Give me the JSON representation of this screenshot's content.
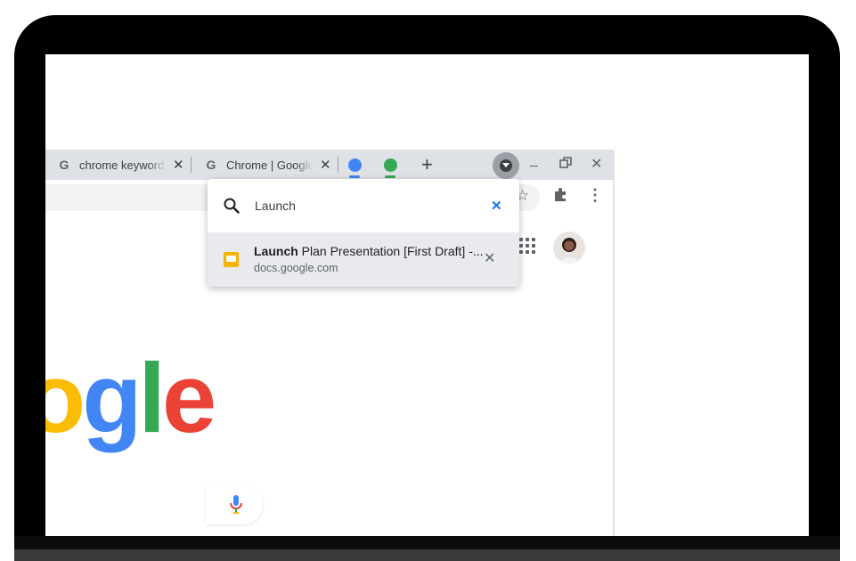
{
  "tabs": [
    {
      "favicon": "G",
      "title": "chrome keywords"
    },
    {
      "favicon": "G",
      "title": "Chrome | Google"
    }
  ],
  "tab_groups": [
    {
      "color": "#4285f4"
    },
    {
      "color": "#34a853"
    }
  ],
  "tab_search": {
    "query": "Launch",
    "result": {
      "title_match": "Launch",
      "title_rest": " Plan Presentation [First Draft] -...",
      "url": "docs.google.com",
      "icon": "slides-icon"
    }
  },
  "page": {
    "logo_letters": [
      {
        "char": "o",
        "color": "#fbbc05"
      },
      {
        "char": "g",
        "color": "#4285f4"
      },
      {
        "char": "l",
        "color": "#34a853"
      },
      {
        "char": "e",
        "color": "#ea4335"
      }
    ]
  },
  "icons": {
    "close": "close-icon",
    "new_tab": "plus-icon",
    "search": "search-icon",
    "mic": "microphone-icon"
  }
}
